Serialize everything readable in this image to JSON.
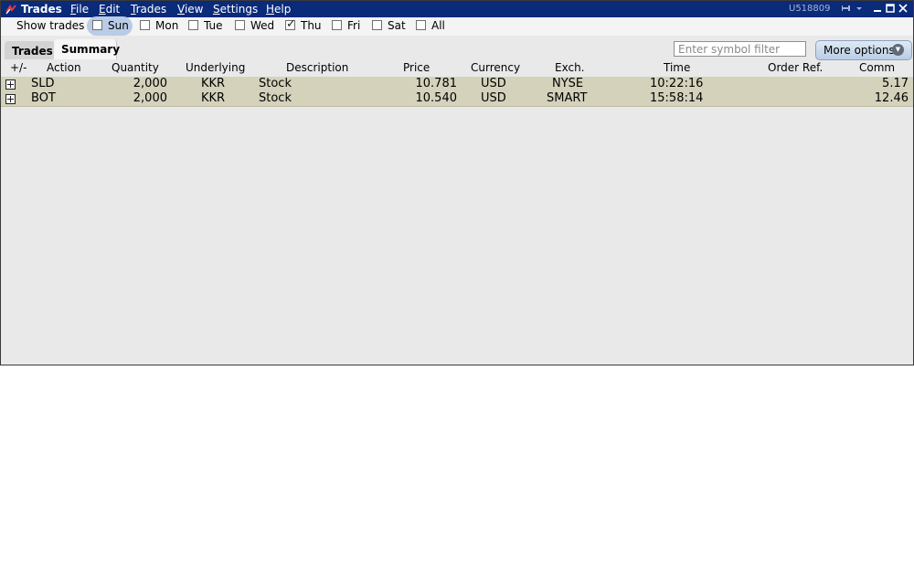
{
  "window": {
    "title": "Trades",
    "account": "U518809"
  },
  "menu": {
    "file": {
      "mn": "F",
      "rest": "ile"
    },
    "edit": {
      "mn": "E",
      "rest": "dit"
    },
    "trades": {
      "mn": "T",
      "rest": "rades"
    },
    "view": {
      "mn": "V",
      "rest": "iew"
    },
    "settings": {
      "mn": "S",
      "rest": "ettings"
    },
    "help": {
      "mn": "H",
      "rest": "elp"
    }
  },
  "show_trades": {
    "label": "Show trades",
    "days": [
      {
        "label": "Sun",
        "checked": false,
        "highlighted": true
      },
      {
        "label": "Mon",
        "checked": false
      },
      {
        "label": "Tue",
        "checked": false
      },
      {
        "label": "Wed",
        "checked": false
      },
      {
        "label": "Thu",
        "checked": true
      },
      {
        "label": "Fri",
        "checked": false
      },
      {
        "label": "Sat",
        "checked": false
      },
      {
        "label": "All",
        "checked": false
      }
    ]
  },
  "tabs": {
    "trades": "Trades",
    "summary": "Summary",
    "active": "Summary"
  },
  "filter": {
    "placeholder": "Enter symbol filter",
    "value": ""
  },
  "more_options": {
    "label": "More options"
  },
  "table": {
    "headers": {
      "expand": "+/-",
      "action": "Action",
      "quantity": "Quantity",
      "underlying": "Underlying",
      "description": "Description",
      "price": "Price",
      "currency": "Currency",
      "exch": "Exch.",
      "time": "Time",
      "order_ref": "Order Ref.",
      "comm": "Comm"
    },
    "rows": [
      {
        "action": "SLD",
        "quantity": "2,000",
        "underlying": "KKR",
        "description": "Stock",
        "price": "10.781",
        "currency": "USD",
        "exch": "NYSE",
        "time": "10:22:16",
        "order_ref": "",
        "comm": "5.17"
      },
      {
        "action": "BOT",
        "quantity": "2,000",
        "underlying": "KKR",
        "description": "Stock",
        "price": "10.540",
        "currency": "USD",
        "exch": "SMART",
        "time": "15:58:14",
        "order_ref": "",
        "comm": "12.46"
      }
    ]
  },
  "colors": {
    "titlebar": "#0a2a7a",
    "row_bg": "#d4d2bb",
    "window_bg": "#e9e9e9"
  }
}
